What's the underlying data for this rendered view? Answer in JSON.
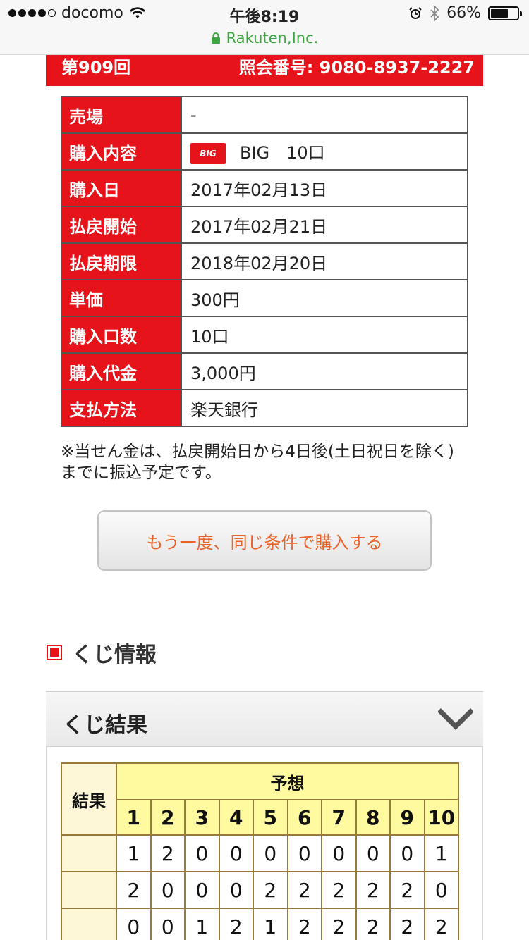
{
  "status_bar": {
    "carrier": "docomo",
    "time": "午後8:19",
    "battery": "66%",
    "battery_fraction": 0.66,
    "url": "Rakuten,Inc."
  },
  "header": {
    "round": "第909回",
    "inquiry": "照会番号: 9080-8937-2227"
  },
  "info_table": [
    {
      "label": "売場",
      "value": "-"
    },
    {
      "label": "購入内容",
      "logo": "BIG",
      "value": "BIG　10口"
    },
    {
      "label": "購入日",
      "value": "2017年02月13日"
    },
    {
      "label": "払戻開始",
      "value": "2017年02月21日"
    },
    {
      "label": "払戻期限",
      "value": "2018年02月20日"
    },
    {
      "label": "単価",
      "value": "300円"
    },
    {
      "label": "購入口数",
      "value": "10口"
    },
    {
      "label": "購入代金",
      "value": "3,000円"
    },
    {
      "label": "支払方法",
      "value": "楽天銀行"
    }
  ],
  "note": "※当せん金は、払戻開始日から4日後(土日祝日を除く)までに振込予定です。",
  "repurchase_button": "もう一度、同じ条件で購入する",
  "section_title": "くじ情報",
  "accordion_title": "くじ結果",
  "results_table": {
    "result_header": "結果",
    "prediction_header": "予想",
    "columns": [
      "1",
      "2",
      "3",
      "4",
      "5",
      "6",
      "7",
      "8",
      "9",
      "10"
    ],
    "rows": [
      {
        "result": "",
        "values": [
          "1",
          "2",
          "0",
          "0",
          "0",
          "0",
          "0",
          "0",
          "0",
          "1"
        ]
      },
      {
        "result": "",
        "values": [
          "2",
          "0",
          "0",
          "0",
          "2",
          "2",
          "2",
          "2",
          "2",
          "0"
        ]
      },
      {
        "result": "",
        "values": [
          "0",
          "0",
          "1",
          "2",
          "1",
          "2",
          "2",
          "2",
          "2",
          "2"
        ]
      }
    ]
  },
  "colors": {
    "brand_red": "#e6131b",
    "button_text": "#e8632a",
    "url_green": "#3ea640",
    "table_header_yellow": "#fffaa0"
  }
}
